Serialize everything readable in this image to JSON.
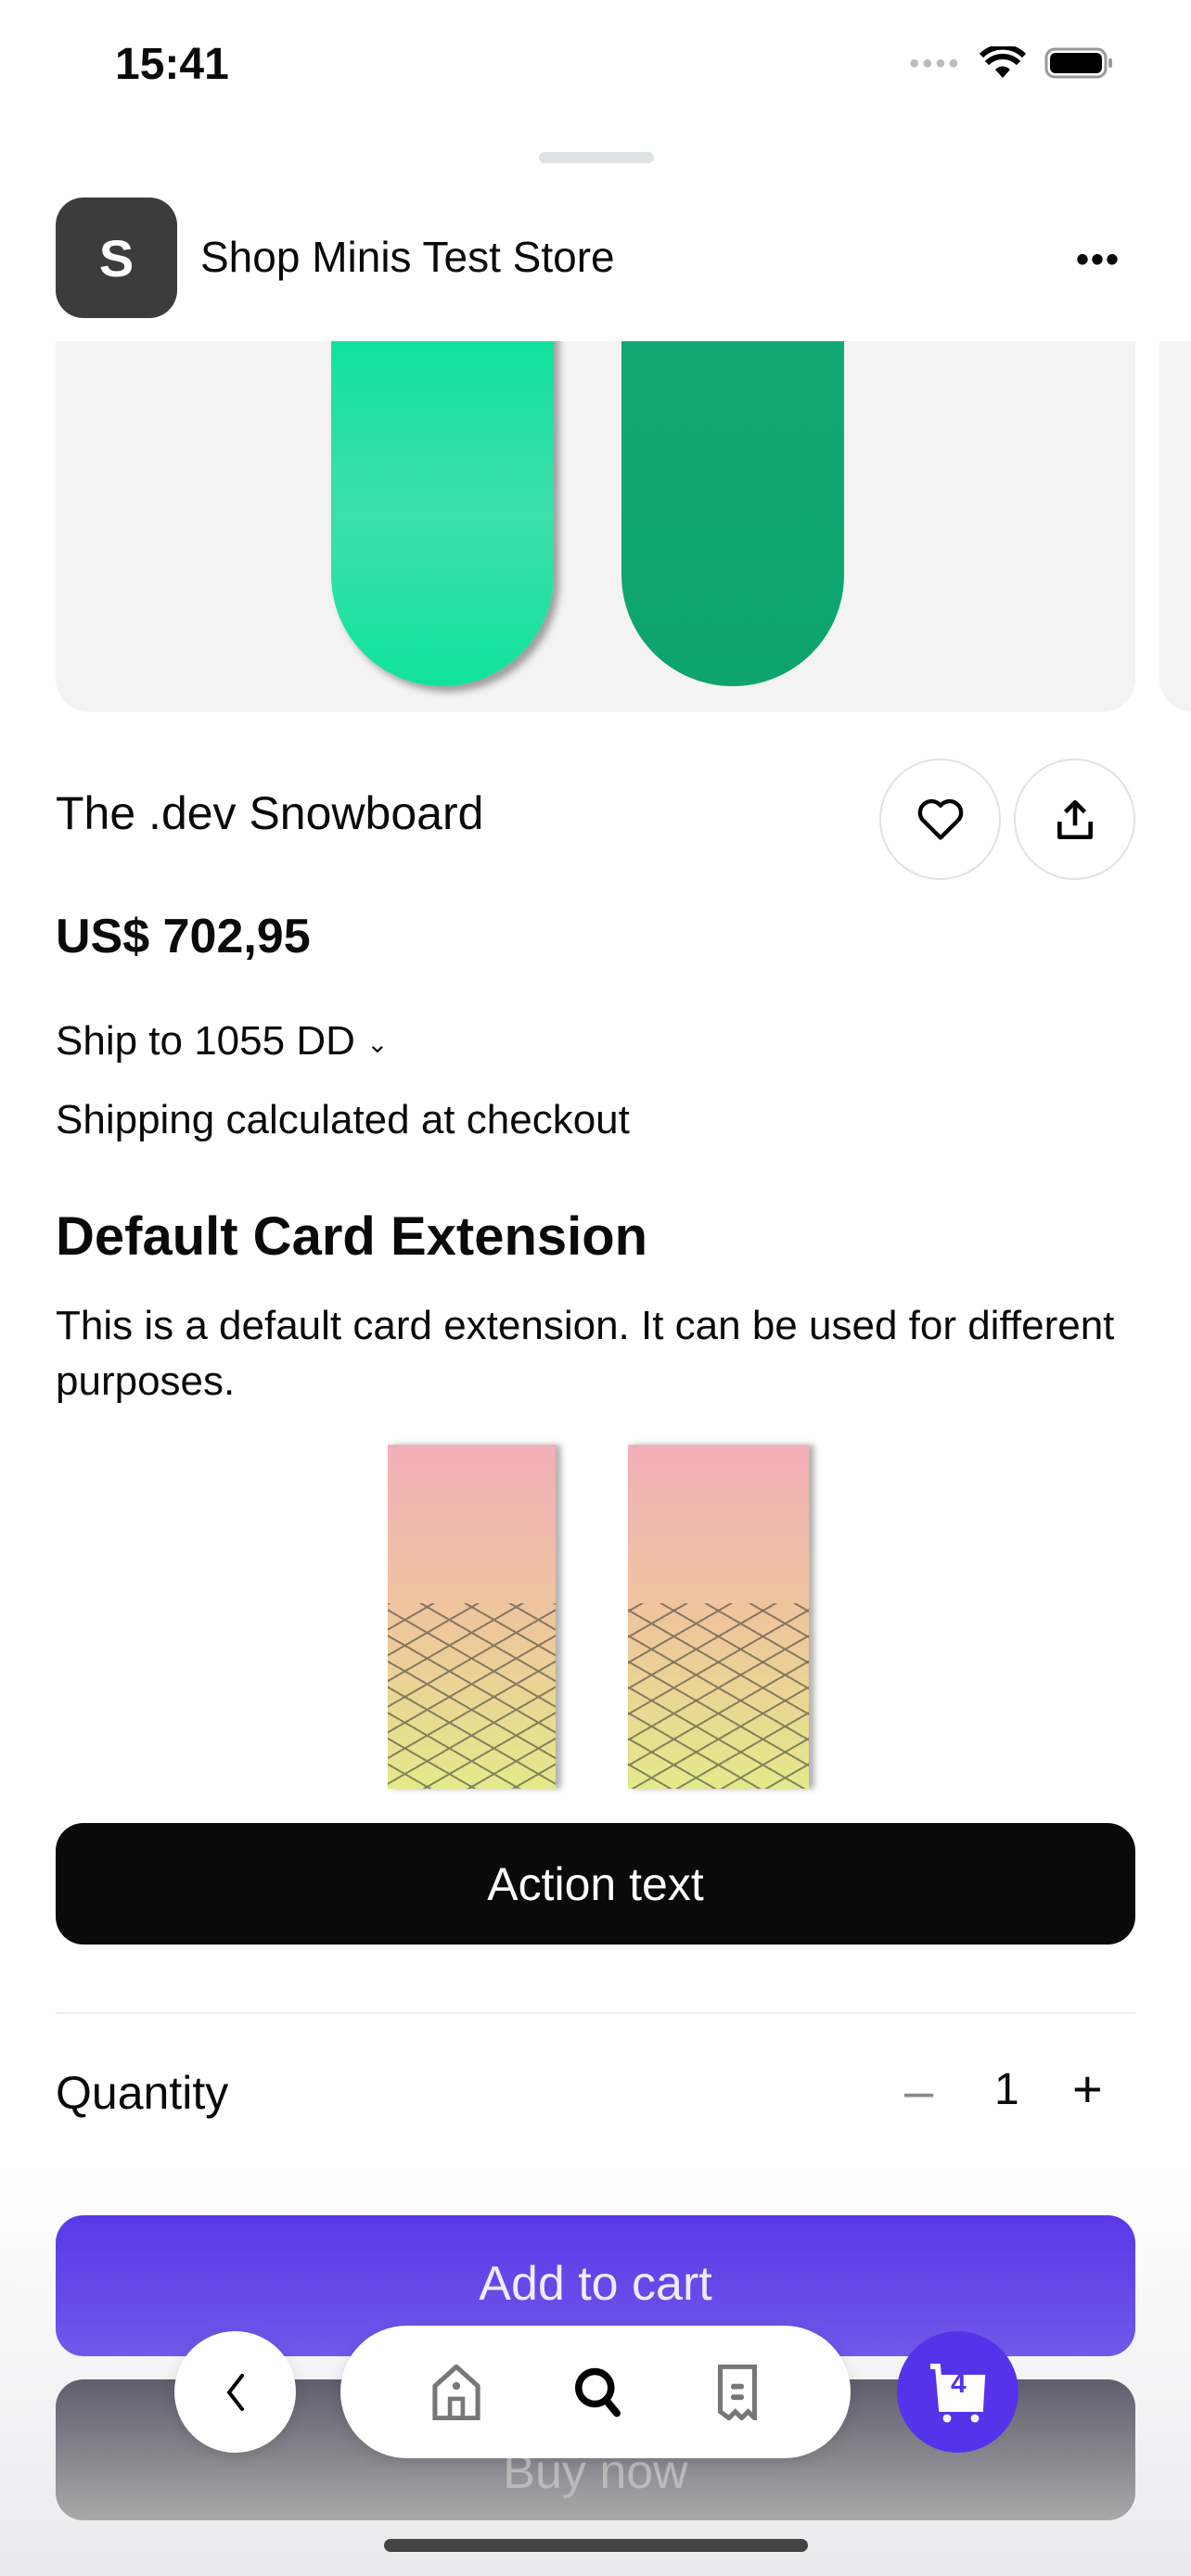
{
  "status_bar": {
    "time": "15:41"
  },
  "header": {
    "logo_letter": "S",
    "store_name": "Shop Minis Test Store",
    "more_label": "•••"
  },
  "product": {
    "title": "The .dev Snowboard",
    "price": "US$ 702,95",
    "ship_to": "Ship to 1055 DD",
    "shipping_note": "Shipping calculated at checkout"
  },
  "extension": {
    "title": "Default Card Extension",
    "description": "This is a default card extension. It can be used for different purposes.",
    "action_label": "Action text"
  },
  "quantity": {
    "label": "Quantity",
    "value": "1",
    "minus": "–",
    "plus": "+"
  },
  "buttons": {
    "add_to_cart": "Add to cart",
    "buy_now": "Buy now"
  },
  "nav": {
    "cart_count": "4"
  },
  "colors": {
    "accent": "#5433ea",
    "add_to_cart": "#5939e8"
  }
}
